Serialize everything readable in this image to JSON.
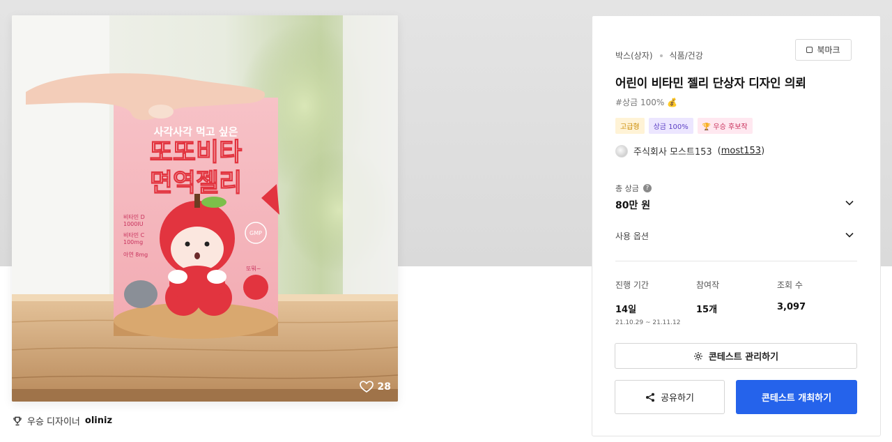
{
  "hero": {
    "likes": "28",
    "box_text": {
      "headline": "사각사각 먹고 싶은",
      "title_line1": "또또비타",
      "title_line2": "면역젤리",
      "nutrient1": "비타민 D",
      "nutrient1_amount": "1000IU",
      "nutrient2": "비타민 C",
      "nutrient2_amount": "100mg",
      "nutrient3": "아연 8mg",
      "seal": "GMP",
      "mascot_note": "또뭐~"
    }
  },
  "winner": {
    "label": "우승 디자이너",
    "name": "oliniz"
  },
  "panel": {
    "breadcrumb": [
      "박스(상자)",
      "식품/건강"
    ],
    "bookmark_label": "북마크",
    "title": "어린이 비타민 젤리 단상자 디자인 의뢰",
    "subtag": "#상금 100% 💰",
    "badges": {
      "grade": "고급형",
      "prize": "상금 100%",
      "winner_candidate": "우승 후보작",
      "winner_icon": "🏆"
    },
    "company": {
      "name": "주식회사 모스트153",
      "handle": "most153"
    },
    "prize": {
      "label": "총 상금",
      "value": "80만 원"
    },
    "options_label": "사용 옵션",
    "stats": {
      "period_label": "진행 기간",
      "period_value": "14일",
      "period_range": "21.10.29 ~ 21.11.12",
      "entries_label": "참여작",
      "entries_value": "15개",
      "views_label": "조회 수",
      "views_value": "3,097"
    },
    "manage_button": "콘테스트 관리하기",
    "share_button": "공유하기",
    "host_button": "콘테스트 개최하기"
  },
  "colors": {
    "primary": "#2563eb",
    "box_pink": "#f5b8c0",
    "apple_red": "#e2343f"
  }
}
